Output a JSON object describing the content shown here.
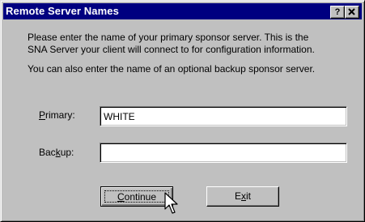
{
  "window": {
    "title": "Remote Server Names",
    "help_label": "?",
    "close_label": "✕"
  },
  "content": {
    "line1": "Please enter the name of your primary sponsor server.  This is the",
    "line2": "SNA Server your client will connect to for configuration information.",
    "line3": "You can also enter the name of an optional backup sponsor server."
  },
  "fields": {
    "primary": {
      "label_prefix": "",
      "label_mnemonic": "P",
      "label_rest": "rimary:",
      "value": "WHITE"
    },
    "backup": {
      "label_prefix": "Bac",
      "label_mnemonic": "k",
      "label_rest": "up:",
      "value": ""
    }
  },
  "buttons": {
    "continue": {
      "prefix": "",
      "mnemonic": "C",
      "rest": "ontinue"
    },
    "exit": {
      "prefix": "E",
      "mnemonic": "x",
      "rest": "it"
    }
  },
  "icons": {
    "cursor": "arrow-cursor-icon",
    "help": "help-icon",
    "close": "close-icon"
  },
  "colors": {
    "titlebar": "#000080",
    "face": "#c0c0c0"
  }
}
